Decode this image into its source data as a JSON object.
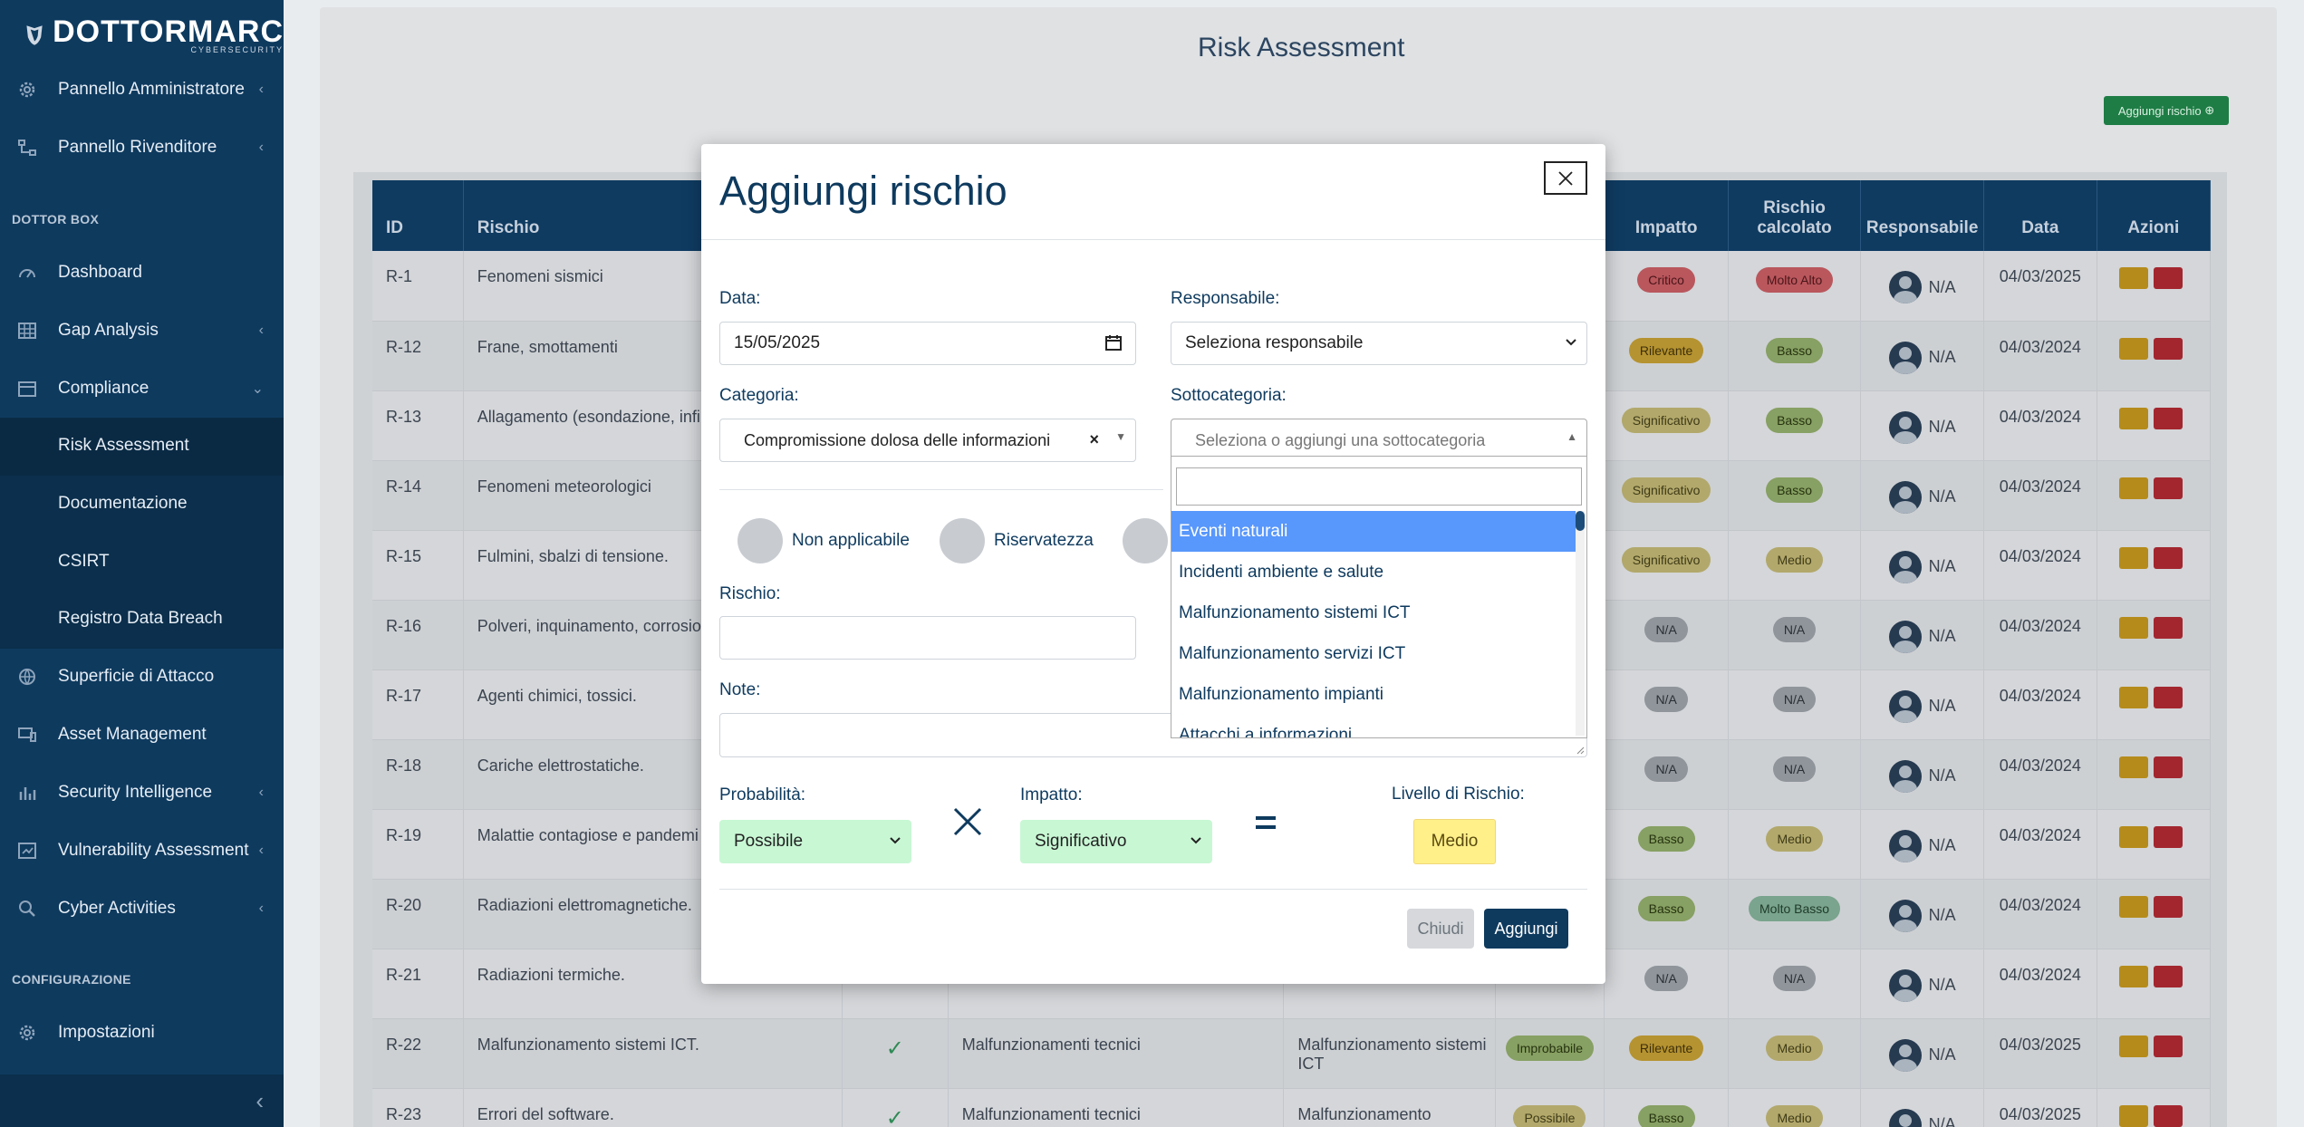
{
  "brand": {
    "name": "DOTTORMARC",
    "tagline": "CYBERSECURITY"
  },
  "sidebar": {
    "items": [
      {
        "label": "Pannello Amministratore",
        "icon": "gear-icon"
      },
      {
        "label": "Pannello Rivenditore",
        "icon": "network-icon"
      },
      {
        "label": "Dashboard",
        "icon": "gauge-icon"
      },
      {
        "label": "Gap Analysis",
        "icon": "grid-icon"
      },
      {
        "label": "Compliance",
        "icon": "calendar-icon"
      },
      {
        "label": "Superficie di Attacco",
        "icon": "globe-icon"
      },
      {
        "label": "Asset Management",
        "icon": "devices-icon"
      },
      {
        "label": "Security Intelligence",
        "icon": "bar-chart-icon"
      },
      {
        "label": "Vulnerability Assessment",
        "icon": "scan-icon"
      },
      {
        "label": "Cyber Activities",
        "icon": "search-icon"
      },
      {
        "label": "Impostazioni",
        "icon": "gear-icon"
      }
    ],
    "sections": {
      "dottor_box": "DOTTOR BOX",
      "configurazione": "CONFIGURAZIONE"
    },
    "compliance_sub": [
      "Risk Assessment",
      "Documentazione",
      "CSIRT",
      "Registro Data Breach"
    ]
  },
  "page": {
    "title": "Risk Assessment",
    "add_button": "Aggiungi rischio"
  },
  "table": {
    "headers": {
      "id": "ID",
      "rischio": "Rischio",
      "impatto": "Impatto",
      "rischio_calcolato": "Rischio calcolato",
      "responsabile": "Responsabile",
      "data": "Data",
      "azioni": "Azioni"
    },
    "rows": [
      {
        "id": "R-1",
        "rischio": "Fenomeni sismici",
        "impatto": "Critico",
        "calc": "Molto Alto",
        "resp": "N/A",
        "data": "04/03/2025"
      },
      {
        "id": "R-12",
        "rischio": "Frane, smottamenti",
        "impatto": "Rilevante",
        "calc": "Basso",
        "resp": "N/A",
        "data": "04/03/2024"
      },
      {
        "id": "R-13",
        "rischio": "Allagamento (esondazione, infil",
        "impatto": "Significativo",
        "calc": "Basso",
        "resp": "N/A",
        "data": "04/03/2024"
      },
      {
        "id": "R-14",
        "rischio": "Fenomeni meteorologici",
        "impatto": "Significativo",
        "calc": "Basso",
        "resp": "N/A",
        "data": "04/03/2024"
      },
      {
        "id": "R-15",
        "rischio": "Fulmini, sbalzi di tensione.",
        "impatto": "Significativo",
        "calc": "Medio",
        "resp": "N/A",
        "data": "04/03/2024"
      },
      {
        "id": "R-16",
        "rischio": "Polveri, inquinamento, corrosion",
        "impatto": "N/A",
        "calc": "N/A",
        "resp": "N/A",
        "data": "04/03/2024"
      },
      {
        "id": "R-17",
        "rischio": "Agenti chimici, tossici.",
        "impatto": "N/A",
        "calc": "N/A",
        "resp": "N/A",
        "data": "04/03/2024"
      },
      {
        "id": "R-18",
        "rischio": "Cariche elettrostatiche.",
        "impatto": "N/A",
        "calc": "N/A",
        "resp": "N/A",
        "data": "04/03/2024"
      },
      {
        "id": "R-19",
        "rischio": "Malattie contagiose e pandemi",
        "impatto": "Basso",
        "calc": "Medio",
        "resp": "N/A",
        "data": "04/03/2024"
      },
      {
        "id": "R-20",
        "rischio": "Radiazioni elettromagnetiche.",
        "impatto": "Basso",
        "calc": "Molto Basso",
        "resp": "N/A",
        "data": "04/03/2024"
      },
      {
        "id": "R-21",
        "rischio": "Radiazioni termiche.",
        "impatto": "N/A",
        "calc": "N/A",
        "resp": "N/A",
        "data": "04/03/2024"
      },
      {
        "id": "R-22",
        "rischio": "Malfunzionamento sistemi ICT.",
        "categoria": "Malfunzionamenti tecnici",
        "sottocat": "Malfunzionamento sistemi ICT",
        "prob": "Improbabile",
        "impatto": "Rilevante",
        "calc": "Medio",
        "resp": "N/A",
        "data": "04/03/2025"
      },
      {
        "id": "R-23",
        "rischio": "Errori del software.",
        "categoria": "Malfunzionamenti tecnici",
        "sottocat": "Malfunzionamento",
        "prob": "Possibile",
        "impatto": "Basso",
        "calc": "Medio",
        "resp": "N/A",
        "data": "04/03/2025"
      }
    ]
  },
  "modal": {
    "title": "Aggiungi rischio",
    "data_label": "Data:",
    "data_value": "15/05/2025",
    "responsabile_label": "Responsabile:",
    "responsabile_value": "Seleziona responsabile",
    "categoria_label": "Categoria:",
    "categoria_value": "Compromissione dolosa delle informazioni",
    "sottocategoria_label": "Sottocategoria:",
    "sottocategoria_placeholder": "Seleziona o aggiungi una sottocategoria",
    "radios": [
      "Non applicabile",
      "Riservatezza"
    ],
    "rischio_label": "Rischio:",
    "note_label": "Note:",
    "probabilita_label": "Probabilità:",
    "probabilita_value": "Possibile",
    "impatto_label": "Impatto:",
    "impatto_value": "Significativo",
    "livello_label": "Livello di Rischio:",
    "livello_value": "Medio",
    "close_button": "Chiudi",
    "add_button": "Aggiungi",
    "dropdown_options": [
      "Eventi naturali",
      "Incidenti ambiente e salute",
      "Malfunzionamento sistemi ICT",
      "Malfunzionamento servizi ICT",
      "Malfunzionamento impianti",
      "Attacchi a informazioni"
    ],
    "highlighted_option": "Eventi naturali"
  },
  "colors": {
    "brand": "#0e3a5e",
    "primary_button": "#0e3a5e",
    "success_select": "#c8f7d4",
    "warning_badge": "#fff08a",
    "highlight": "#5897fb"
  }
}
